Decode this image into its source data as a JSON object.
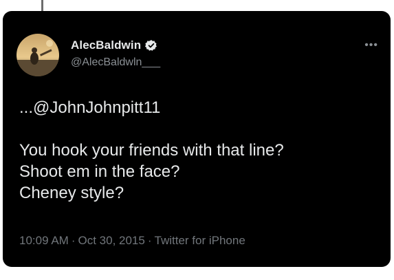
{
  "tweet": {
    "display_name": "AlecBaldwin",
    "handle": "@AlecBaldwln___",
    "verified": true,
    "more_icon": "more-dots-icon",
    "avatar_icon": "profile-photo",
    "lines": [
      "...@JohnJohnpitt11",
      "",
      "You hook your friends with that line?",
      "Shoot em in the face?",
      "Cheney style?"
    ],
    "time": "10:09 AM",
    "date": "Oct 30, 2015",
    "source": "Twitter for iPhone",
    "separator": "·"
  },
  "colors": {
    "card_background": "#000000",
    "text_primary": "#e7e9ea",
    "text_secondary": "#71767b",
    "verified_badge": "#e7e9ea"
  }
}
